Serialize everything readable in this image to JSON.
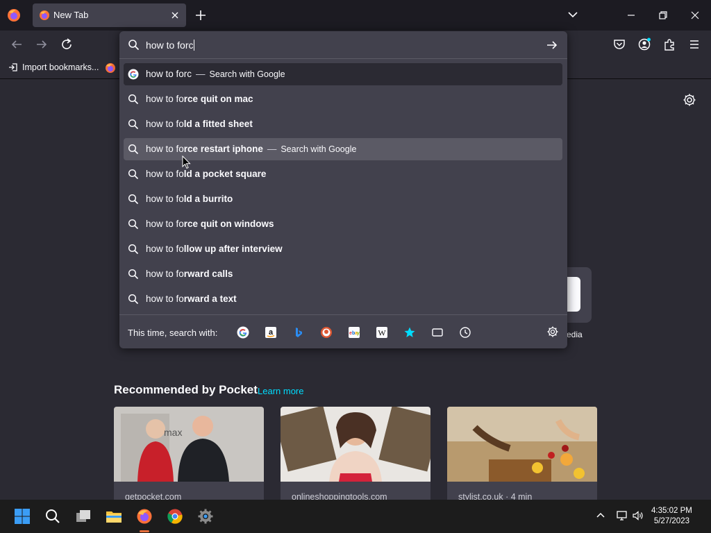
{
  "browser": {
    "tab": {
      "title": "New Tab",
      "favicon": "firefox-icon"
    },
    "bookmarks": [
      {
        "label": "Import bookmarks...",
        "icon": "import-icon"
      },
      {
        "label": "",
        "icon": "firefox-icon"
      }
    ]
  },
  "urlbar": {
    "typed_text": "how to forc",
    "heuristic": {
      "text": "how to forc",
      "separator": "—",
      "action": "Search with Google",
      "icon": "google-icon"
    },
    "suggestions": [
      {
        "prefix": "how to fo",
        "bold": "rce quit on mac",
        "action": ""
      },
      {
        "prefix": "how to fo",
        "bold": "ld a fitted sheet",
        "action": ""
      },
      {
        "prefix": "how to fo",
        "bold": "rce restart iphone",
        "action": "Search with Google",
        "separator": "—"
      },
      {
        "prefix": "how to fo",
        "bold": "ld a pocket square",
        "action": ""
      },
      {
        "prefix": "how to fo",
        "bold": "ld a burrito",
        "action": ""
      },
      {
        "prefix": "how to fo",
        "bold": "rce quit on windows",
        "action": ""
      },
      {
        "prefix": "how to fo",
        "bold": "llow up after interview",
        "action": ""
      },
      {
        "prefix": "how to fo",
        "bold": "rward calls",
        "action": ""
      },
      {
        "prefix": "how to fo",
        "bold": "rward a text",
        "action": ""
      }
    ],
    "one_off": {
      "label": "This time, search with:",
      "engines": [
        "google-icon",
        "amazon-icon",
        "bing-icon",
        "duckduckgo-icon",
        "ebay-icon",
        "wikipedia-icon",
        "bookmarks-star-icon",
        "tabs-icon",
        "history-icon"
      ]
    }
  },
  "newtab": {
    "topsite_label": "edia",
    "pocket": {
      "title": "Recommended by Pocket",
      "learn_more": "Learn more",
      "cards": [
        {
          "source": "getpocket.com"
        },
        {
          "source": "onlineshoppingtools.com"
        },
        {
          "source": "stylist.co.uk · 4 min"
        }
      ]
    }
  },
  "taskbar": {
    "time": "4:35:02 PM",
    "date": "5/27/2023"
  },
  "colors": {
    "accent": "#00ddff",
    "chrome_bg": "#1c1b22",
    "panel_bg": "#42414d",
    "page_bg": "#2b2a33"
  }
}
